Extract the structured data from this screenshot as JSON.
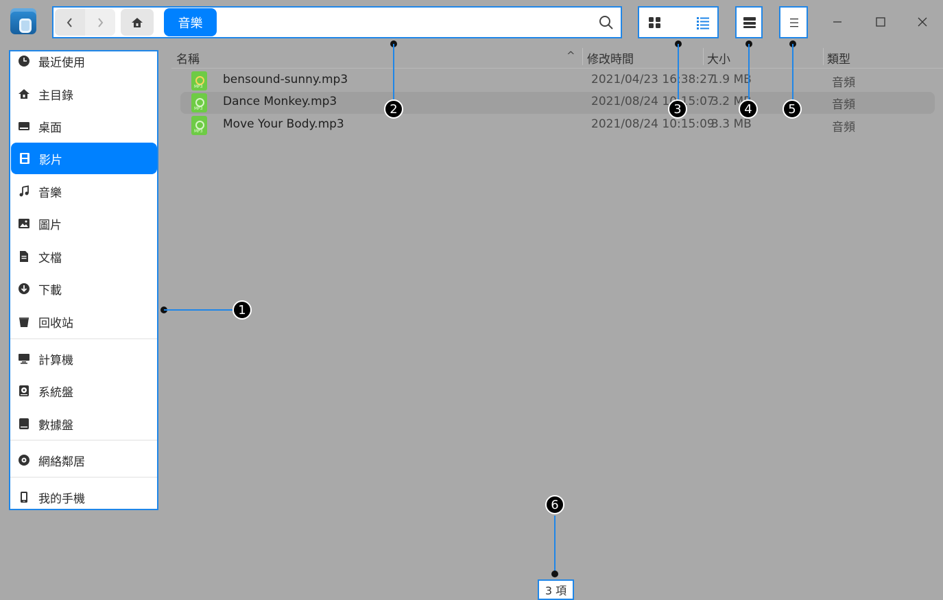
{
  "addressbar": {
    "back_icon": "chevron-left-icon",
    "forward_icon": "chevron-right-icon",
    "home_icon": "home-icon",
    "breadcrumb": "音樂",
    "search_icon": "search-icon"
  },
  "toolbar": {
    "icon_view_icon": "grid-icon",
    "list_view_icon": "list-icon",
    "detail_icon": "detail-panel-icon",
    "menu_icon": "hamburger-menu-icon"
  },
  "sidebar": {
    "items": [
      {
        "label": "最近使用",
        "icon": "clock-icon"
      },
      {
        "label": "主目錄",
        "icon": "home-icon"
      },
      {
        "label": "桌面",
        "icon": "desktop-icon"
      },
      {
        "label": "影片",
        "icon": "film-icon",
        "active": true
      },
      {
        "label": "音樂",
        "icon": "music-note-icon"
      },
      {
        "label": "圖片",
        "icon": "picture-icon"
      },
      {
        "label": "文檔",
        "icon": "document-icon"
      },
      {
        "label": "下載",
        "icon": "download-icon"
      },
      {
        "label": "回收站",
        "icon": "trash-icon"
      },
      {
        "label": "計算機",
        "icon": "computer-icon"
      },
      {
        "label": "系統盤",
        "icon": "system-disk-icon"
      },
      {
        "label": "數據盤",
        "icon": "data-disk-icon"
      },
      {
        "label": "網絡鄰居",
        "icon": "network-icon"
      },
      {
        "label": "我的手機",
        "icon": "phone-icon"
      }
    ]
  },
  "columns": {
    "name": "名稱",
    "modified": "修改時間",
    "size": "大小",
    "type": "類型"
  },
  "files": [
    {
      "name": "bensound-sunny.mp3",
      "modified": "2021/04/23 16:38:27",
      "size": "1.9 MB",
      "type": "音頻"
    },
    {
      "name": "Dance Monkey.mp3",
      "modified": "2021/08/24 10:15:07",
      "size": "3.2 MB",
      "type": "音頻"
    },
    {
      "name": "Move Your Body.mp3",
      "modified": "2021/08/24 10:15:09",
      "size": "3.3 MB",
      "type": "音頻"
    }
  ],
  "status": {
    "count": "3 項"
  },
  "callouts": [
    "1",
    "2",
    "3",
    "4",
    "5",
    "6"
  ],
  "colors": {
    "accent": "#0081ff",
    "highlight_border": "#1f86e8",
    "overlay": "#a9a9a9",
    "mp3_icon": "#6ecb45"
  }
}
